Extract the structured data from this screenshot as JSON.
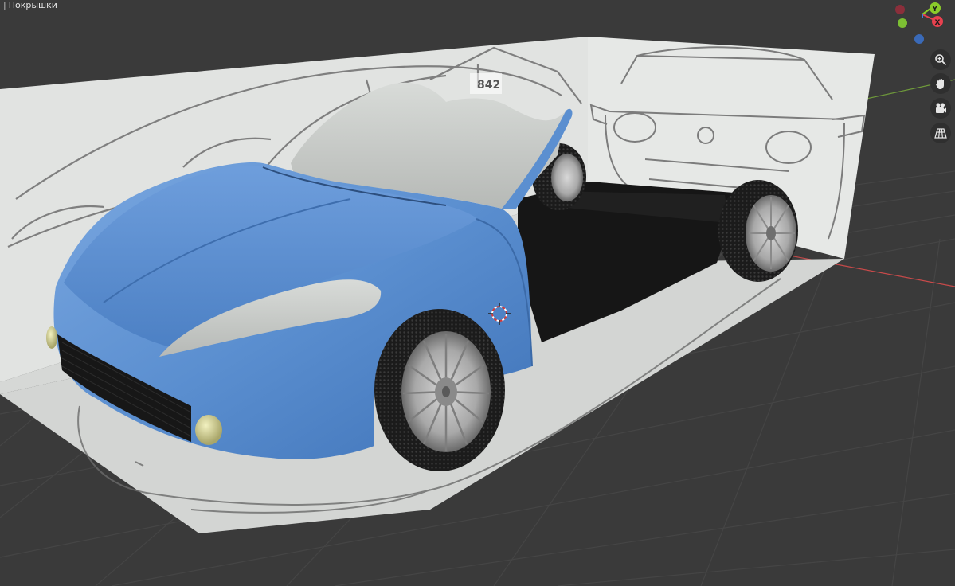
{
  "header": {
    "object_name": "Покрышки"
  },
  "gizmo": {
    "axis_y_label": "Y",
    "axis_x_label": "X",
    "colors": {
      "x": "#e8414f",
      "y": "#8acb2a",
      "z": "#3d7fdc",
      "x_neg": "#8b2f3b",
      "y_neg": "#7cbf33",
      "z_neg": "#3a6ab8"
    }
  },
  "nav": {
    "icons": [
      "zoom-icon",
      "hand-pan-icon",
      "camera-icon",
      "grid-perspective-icon"
    ]
  },
  "reference": {
    "front_badge_number": "842"
  },
  "colors": {
    "viewport_bg": "#3a3a3a",
    "body_paint": "#5b8fd0",
    "interior_gray": "#c9ccc9",
    "reference_paper": "#e1e3e1",
    "axis_red": "#c84a4a",
    "axis_green": "#6f9a3a"
  }
}
